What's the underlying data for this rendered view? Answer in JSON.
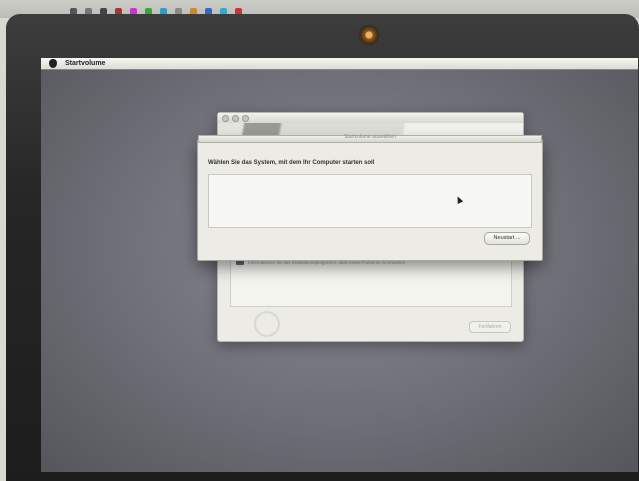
{
  "menubar": {
    "app_name": "Startvolume"
  },
  "installer": {
    "info_text": "Informationen für das Installationsprogramm, dass keine Probleme zu erwarten",
    "continue_label": "Fortfahren"
  },
  "sheet": {
    "title": "Startvolume auswählen",
    "prompt": "Wählen Sie das System, mit dem Ihr Computer starten soll",
    "restart_label": "Neustart ..."
  },
  "colors": {
    "screen": "#6e6e76",
    "window": "#ecebe6",
    "bezel": "#262626"
  },
  "icons": [
    "apple-logo-icon",
    "camera-icon",
    "mouse-cursor-icon",
    "disc-icon"
  ]
}
